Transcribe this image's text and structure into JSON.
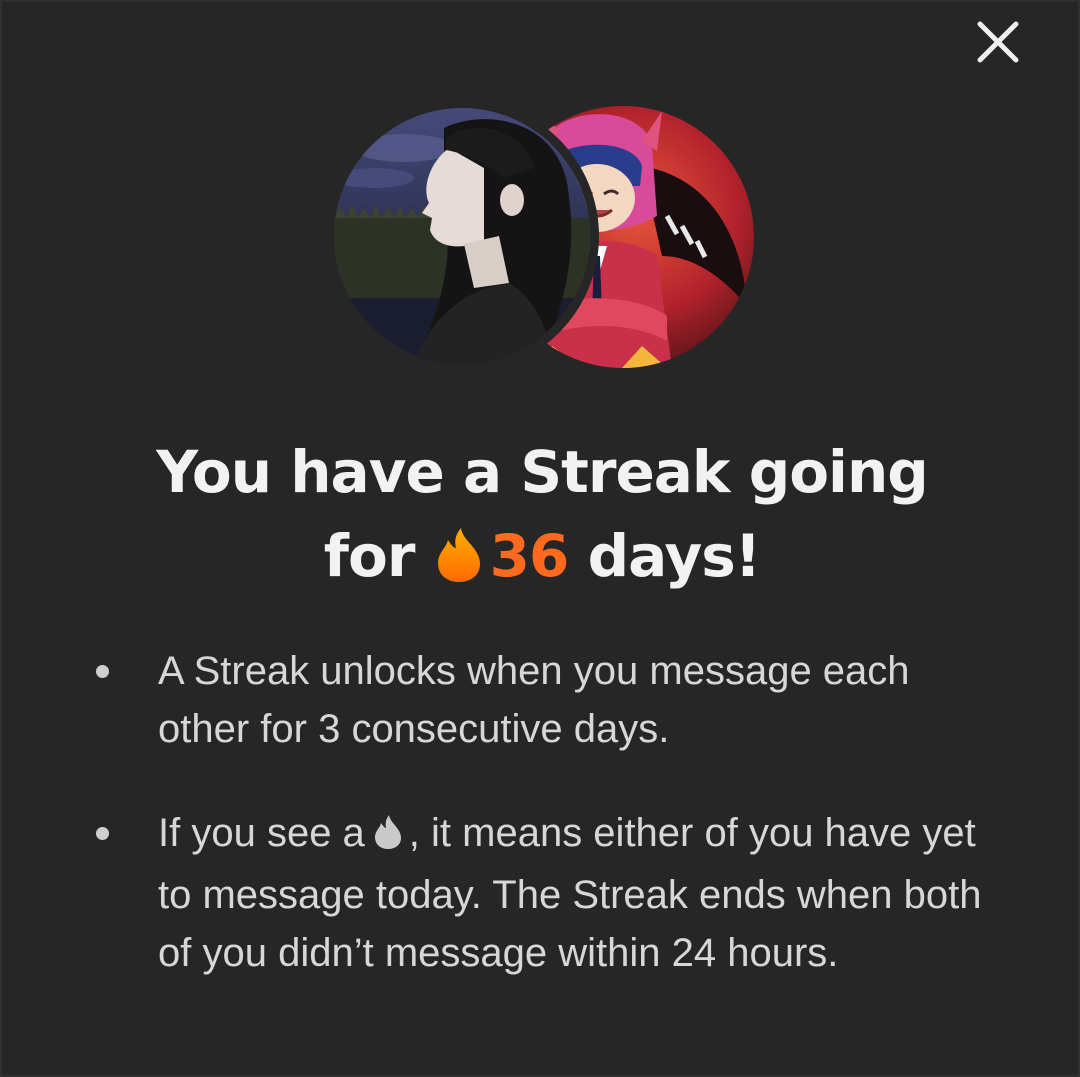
{
  "modal": {
    "close_icon": "close-icon",
    "avatars": [
      {
        "name": "avatar-user-left",
        "palette": [
          "#3a3f5c",
          "#1d2232",
          "#23281f"
        ]
      },
      {
        "name": "avatar-user-right",
        "palette": [
          "#c2313a",
          "#2a1414",
          "#d43a88"
        ]
      }
    ],
    "title": {
      "prefix": "You have a Streak going",
      "for_word": "for",
      "streak_count": "36",
      "suffix": "days!",
      "flame_icon": "flame-icon",
      "count_color": "#ff6a1e"
    },
    "bullets": [
      {
        "text": "A Streak unlocks when you message each other for 3 consecutive days."
      },
      {
        "text_before": "If you see a",
        "icon": "grey-flame-icon",
        "text_after": ", it means either of you have yet to message today. The Streak ends when both of you didn’t message within 24 hours."
      }
    ]
  }
}
